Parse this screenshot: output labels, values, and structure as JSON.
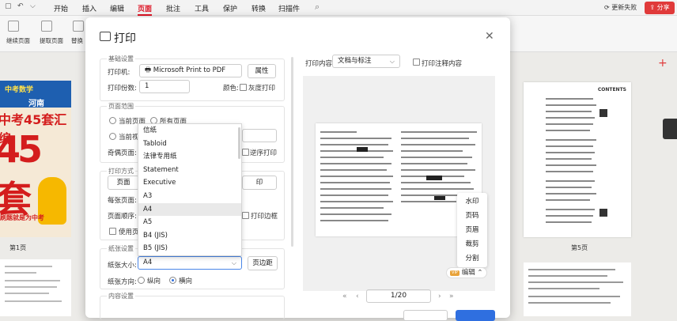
{
  "ribbon": {
    "tabs": [
      "开始",
      "插入",
      "编辑",
      "页面",
      "批注",
      "工具",
      "保护",
      "转换",
      "扫描件"
    ],
    "active_tab": "页面",
    "update_label": "更新失败",
    "share_label": "分享",
    "tools": [
      "继续页面",
      "提取页面",
      "替换"
    ]
  },
  "left_thumb": {
    "banner_line1": "中考数学",
    "banner_line2": "河南",
    "title": "中考45套汇编",
    "big_text": "45套",
    "promo": "刷题就是为中考",
    "page_label": "第1页"
  },
  "right_thumb": {
    "header": "CONTENTS",
    "page_label": "第5页"
  },
  "dialog": {
    "title": "打印",
    "basic_group": "基础设置",
    "printer_label": "打印机:",
    "printer_value": "Microsoft Print to PDF",
    "properties_button": "属性",
    "copies_label": "打印份数:",
    "copies_value": "1",
    "color_label": "颜色:",
    "gray_label": "灰度打印",
    "range_group": "页面范围",
    "current_page": "当前页面",
    "all_pages": "所有页面",
    "current_selection": "当前视图",
    "odd_even_label": "奇偶页面:",
    "reverse_label": "逆序打印",
    "mode_group": "打印方式",
    "page_btn": "页面",
    "sheets_label": "每张页面:",
    "sheets_suffix": "印",
    "order_label": "页面顺序:",
    "border_label": "打印边框",
    "use_label": "使用页面",
    "paper_group": "纸张设置",
    "size_label": "纸张大小:",
    "size_value": "A4",
    "margin_button": "页边距",
    "orientation_label": "纸张方向:",
    "portrait": "纵向",
    "landscape": "横向",
    "content_group": "内容设置",
    "print_content_label": "打印内容:",
    "print_content_value": "文档与标注",
    "annotation_label": "打印注释内容",
    "paper_options": [
      "信纸",
      "Tabloid",
      "法律专用纸",
      "Statement",
      "Executive",
      "A3",
      "A4",
      "A5",
      "B4 (JIS)",
      "B5 (JIS)"
    ],
    "paper_selected": "A4",
    "context_items": [
      "水印",
      "页码",
      "页眉",
      "裁剪",
      "分割"
    ],
    "edit_label": "编辑",
    "edit_badge": "VIP",
    "page_indicator": "1/20"
  }
}
